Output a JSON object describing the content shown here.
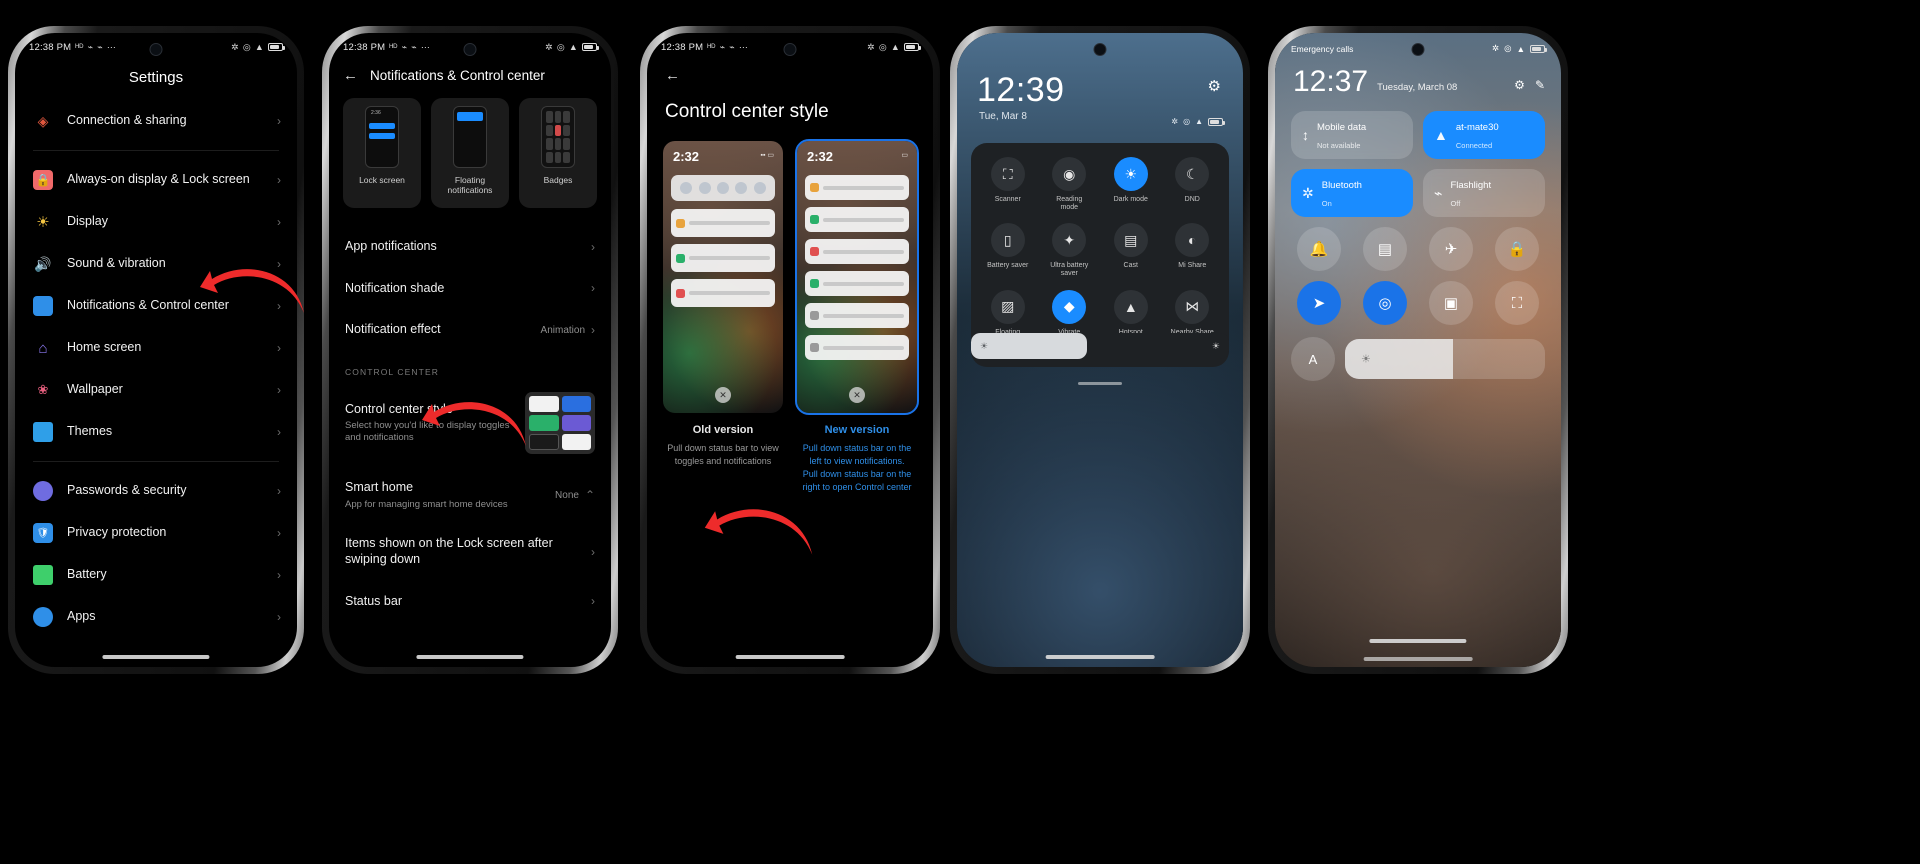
{
  "phone1": {
    "statusbar": {
      "time": "12:38 PM",
      "left_icons": [
        "hd-icon",
        "mute-icon",
        "mute-icon",
        "more-icon"
      ],
      "right_icons": [
        "bluetooth-icon",
        "alarm-icon",
        "wifi-icon",
        "battery-icon"
      ]
    },
    "title": "Settings",
    "items": [
      {
        "label": "Connection & sharing",
        "icon": "connection-icon",
        "color": "#e0573e"
      },
      {
        "label": "Always-on display & Lock screen",
        "icon": "lock-icon",
        "color": "#f06a6a"
      },
      {
        "label": "Display",
        "icon": "display-icon",
        "color": "#f5c542"
      },
      {
        "label": "Sound & vibration",
        "icon": "sound-icon",
        "color": "#27c36b"
      },
      {
        "label": "Notifications & Control center",
        "icon": "notifications-icon",
        "color": "#2f8fe8"
      },
      {
        "label": "Home screen",
        "icon": "home-icon",
        "color": "#8e7bf5"
      },
      {
        "label": "Wallpaper",
        "icon": "wallpaper-icon",
        "color": "#e8607f"
      },
      {
        "label": "Themes",
        "icon": "themes-icon",
        "color": "#2f9fe8"
      },
      {
        "label": "Passwords & security",
        "icon": "security-icon",
        "color": "#6f6ce0"
      },
      {
        "label": "Privacy protection",
        "icon": "privacy-icon",
        "color": "#2f8fe8"
      },
      {
        "label": "Battery",
        "icon": "battery-icon",
        "color": "#3ecf6b"
      },
      {
        "label": "Apps",
        "icon": "apps-icon",
        "color": "#2f8fe8"
      }
    ],
    "chevron": "›"
  },
  "phone2": {
    "statusbar": {
      "time": "12:38 PM"
    },
    "back_icon": "back-arrow-icon",
    "title": "Notifications & Control center",
    "cards": [
      {
        "label": "Lock screen",
        "preview_time": "2:36"
      },
      {
        "label": "Floating notifications"
      },
      {
        "label": "Badges"
      }
    ],
    "rows": [
      {
        "label": "App notifications",
        "value": ""
      },
      {
        "label": "Notification shade",
        "value": ""
      },
      {
        "label": "Notification effect",
        "value": "Animation"
      }
    ],
    "section_header": "CONTROL CENTER",
    "control_center_style": {
      "label": "Control center style",
      "desc": "Select how you'd like to display toggles and notifications"
    },
    "smart_home": {
      "label": "Smart home",
      "desc": "App for managing smart home devices",
      "value": "None"
    },
    "lock_items": {
      "label": "Items shown on the Lock screen after swiping down"
    },
    "status_bar": {
      "label": "Status bar"
    },
    "chevron": "›"
  },
  "phone3": {
    "statusbar": {
      "time": "12:38 PM"
    },
    "back_icon": "back-arrow-icon",
    "title": "Control center style",
    "options": [
      {
        "name": "Old version",
        "desc": "Pull down status bar to view toggles and notifications",
        "preview_time": "2:32",
        "selected": false
      },
      {
        "name": "New version",
        "desc": "Pull down status bar on the left to view notifications. Pull down status bar on the right to open Control center",
        "preview_time": "2:32",
        "selected": true
      }
    ]
  },
  "phone4": {
    "clock": "12:39",
    "date": "Tue, Mar 8",
    "gear_icon": "gear-icon",
    "status_icons": [
      "bluetooth-icon",
      "alarm-icon",
      "wifi-icon",
      "battery-icon"
    ],
    "tiles": [
      {
        "label": "Scanner",
        "icon": "scanner-icon",
        "on": false
      },
      {
        "label": "Reading mode",
        "icon": "reading-mode-icon",
        "on": false
      },
      {
        "label": "Dark mode",
        "icon": "dark-mode-icon",
        "on": true
      },
      {
        "label": "DND",
        "icon": "dnd-icon",
        "on": false
      },
      {
        "label": "Battery saver",
        "icon": "battery-saver-icon",
        "on": false
      },
      {
        "label": "Ultra battery saver",
        "icon": "ultra-battery-saver-icon",
        "on": false
      },
      {
        "label": "Cast",
        "icon": "cast-icon",
        "on": false
      },
      {
        "label": "Mi Share",
        "icon": "mi-share-icon",
        "on": false
      },
      {
        "label": "Floating windows",
        "icon": "floating-windows-icon",
        "on": false
      },
      {
        "label": "Vibrate",
        "icon": "vibrate-icon",
        "on": true
      },
      {
        "label": "Hotspot",
        "icon": "hotspot-icon",
        "on": false
      },
      {
        "label": "Nearby Share",
        "icon": "nearby-share-icon",
        "on": false
      }
    ],
    "page_dots": 3,
    "active_dot": 1,
    "brightness": {
      "left_icon": "brightness-low-icon",
      "right_icon": "brightness-high-icon",
      "level": 45
    }
  },
  "phone5": {
    "statusbar": {
      "left": "Emergency calls",
      "right_icons": [
        "bluetooth-icon",
        "alarm-icon",
        "wifi-icon",
        "battery-icon"
      ]
    },
    "clock": "12:37",
    "date": "Tuesday, March 08",
    "actions": [
      "gear-icon",
      "edit-icon"
    ],
    "big_tiles": [
      {
        "title": "Mobile data",
        "sub": "Not available",
        "icon": "mobile-data-icon",
        "on": false
      },
      {
        "title": "at-mate30",
        "sub": "Connected",
        "icon": "wifi-icon",
        "on": true
      },
      {
        "title": "Bluetooth",
        "sub": "On",
        "icon": "bluetooth-icon",
        "on": true
      },
      {
        "title": "Flashlight",
        "sub": "Off",
        "icon": "flashlight-icon",
        "on": false
      }
    ],
    "small_tiles": [
      {
        "label": "silent-icon",
        "icon": "bell-icon",
        "on": false
      },
      {
        "label": "screenshot-icon",
        "icon": "screenshot-icon",
        "on": false
      },
      {
        "label": "airplane-icon",
        "icon": "airplane-icon",
        "on": false
      },
      {
        "label": "lock-rotation-icon",
        "icon": "lock-icon",
        "on": false
      },
      {
        "label": "location-icon",
        "icon": "location-icon",
        "on": true
      },
      {
        "label": "sync-icon",
        "icon": "sync-icon",
        "on": true
      },
      {
        "label": "screen-record-icon",
        "icon": "video-icon",
        "on": false
      },
      {
        "label": "cast-icon",
        "icon": "cast-icon",
        "on": false
      }
    ],
    "auto_brightness": {
      "icon": "auto-brightness-icon",
      "label": "A"
    },
    "brightness": {
      "icon": "brightness-icon",
      "level": 54
    }
  }
}
